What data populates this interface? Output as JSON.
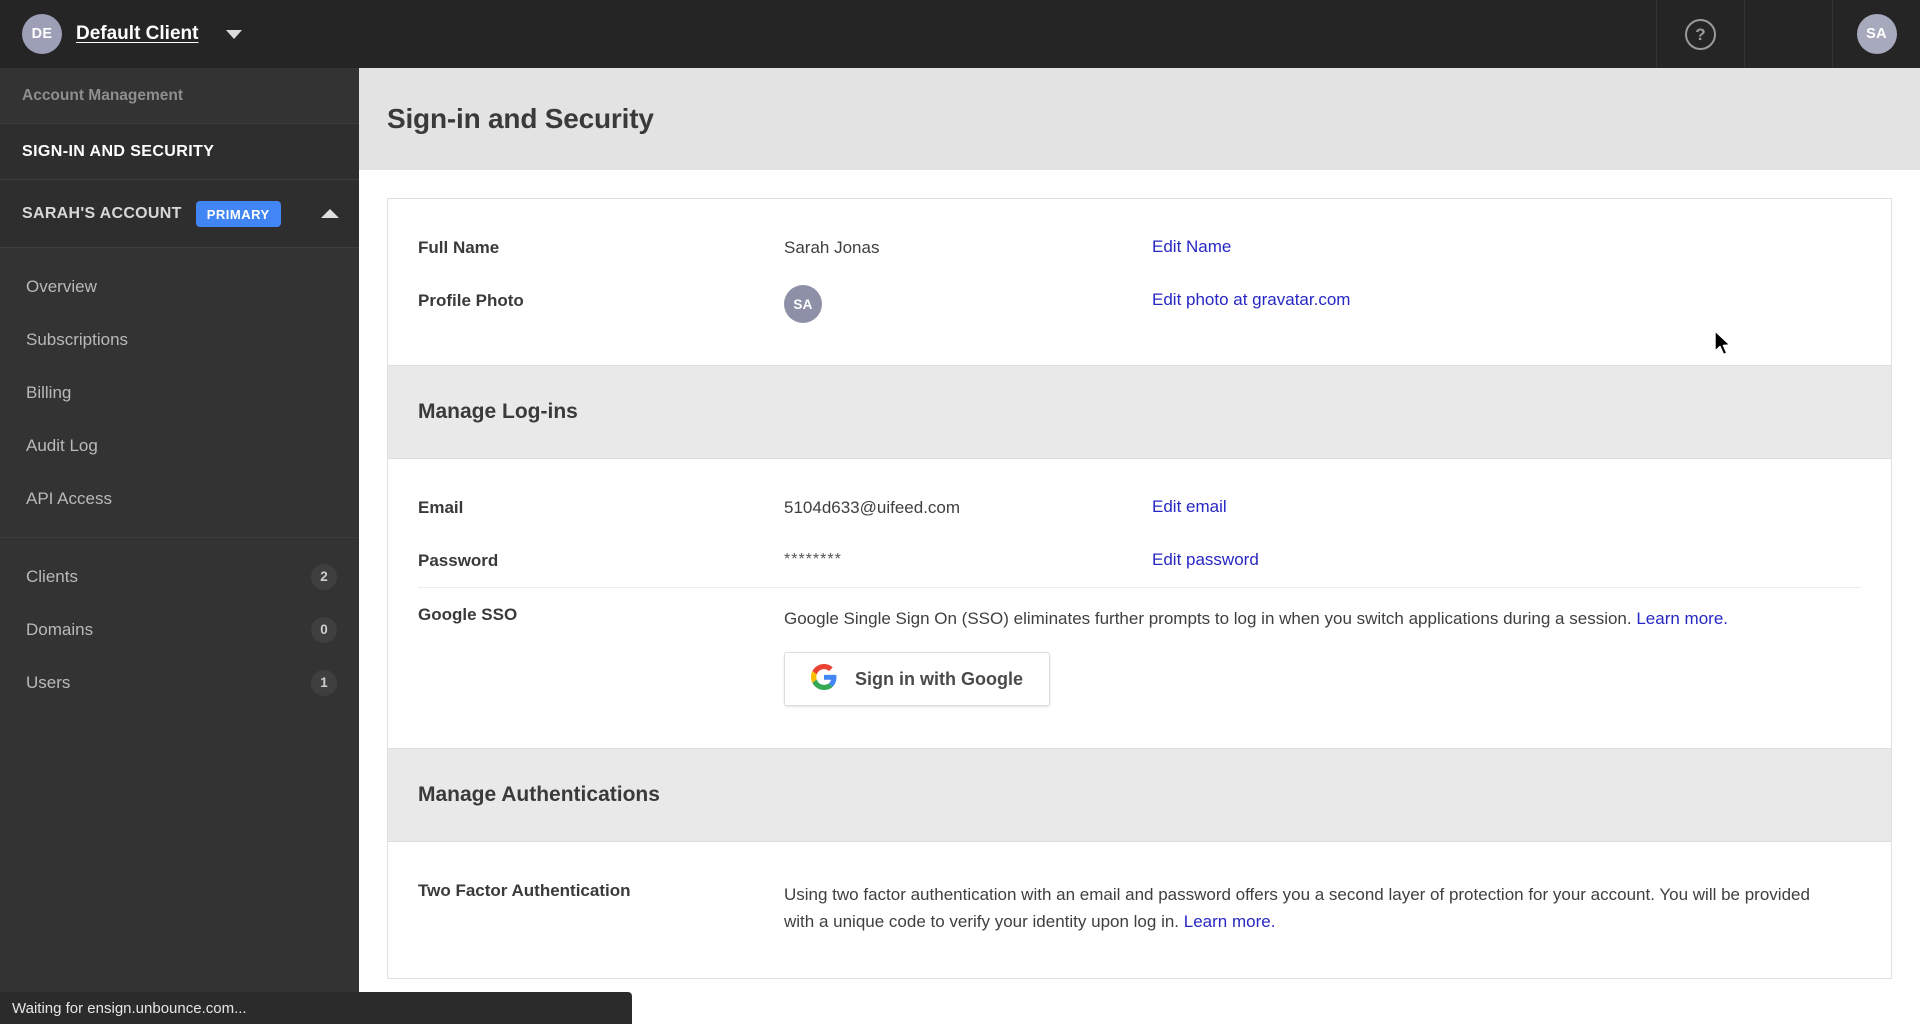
{
  "sidebar": {
    "client": {
      "initials": "DE",
      "name": "Default Client",
      "caret_icon": "chevron-down-icon"
    },
    "section_label": "Account Management",
    "primary_nav": "SIGN-IN AND SECURITY",
    "account": {
      "name": "SARAH'S ACCOUNT",
      "badge": "PRIMARY",
      "collapse_icon": "chevron-up-icon"
    },
    "groups": [
      {
        "items": [
          {
            "label": "Overview",
            "count": null
          },
          {
            "label": "Subscriptions",
            "count": null
          },
          {
            "label": "Billing",
            "count": null
          },
          {
            "label": "Audit Log",
            "count": null
          },
          {
            "label": "API Access",
            "count": null
          }
        ]
      },
      {
        "items": [
          {
            "label": "Clients",
            "count": "2"
          },
          {
            "label": "Domains",
            "count": "0"
          },
          {
            "label": "Users",
            "count": "1"
          }
        ]
      }
    ]
  },
  "topbar": {
    "help_icon": "question-mark-circle-icon",
    "help_label": "?",
    "user_initials": "SA"
  },
  "header": {
    "title": "Sign-in and Security"
  },
  "profile_card": {
    "rows": [
      {
        "label": "Full Name",
        "value": "Sarah Jonas",
        "action": "Edit Name"
      },
      {
        "label": "Profile Photo",
        "value_initials": "SA",
        "action": "Edit photo at gravatar.com"
      }
    ]
  },
  "logins_card": {
    "title": "Manage Log-ins",
    "email": {
      "label": "Email",
      "value": "5104d633@uifeed.com",
      "action": "Edit email"
    },
    "password": {
      "label": "Password",
      "value": "********",
      "action": "Edit password"
    },
    "sso": {
      "label": "Google SSO",
      "description": "Google Single Sign On (SSO) eliminates further prompts to log in when you switch applications during a session.",
      "learn_more": "Learn more.",
      "button_label": "Sign in with Google",
      "button_icon": "google-g-icon"
    }
  },
  "auth_card": {
    "title": "Manage Authentications",
    "two_factor": {
      "label": "Two Factor Authentication",
      "description": "Using two factor authentication with an email and password offers you a second layer of protection for your account. You will be provided with a unique code to verify your identity upon log in.",
      "learn_more": "Learn more."
    }
  },
  "statusbar": {
    "text": "Waiting for ensign.unbounce.com..."
  },
  "colors": {
    "sidebar_bg": "#333333",
    "sidebar_dark": "#252525",
    "accent_blue": "#4285f4",
    "link_blue": "#2727c4",
    "header_bg": "#e3e3e3",
    "card_header_bg": "#e9e9e9"
  }
}
